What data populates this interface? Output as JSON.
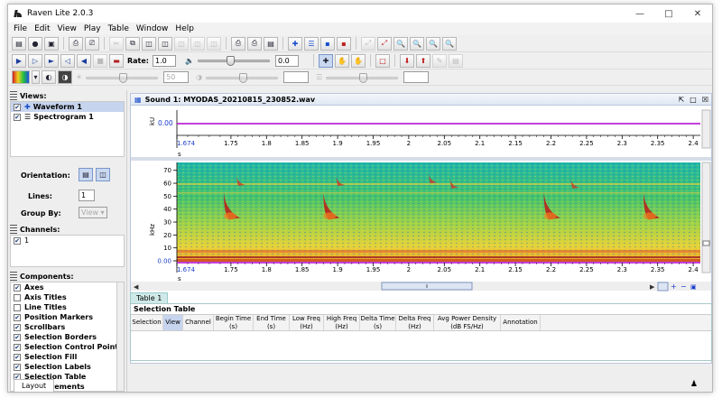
{
  "window": {
    "title": "Raven Lite 2.0.3",
    "minimize_icon": "minimize-icon",
    "maximize_icon": "maximize-icon",
    "close_icon": "close-icon"
  },
  "menu": [
    "File",
    "Edit",
    "View",
    "Play",
    "Table",
    "Window",
    "Help"
  ],
  "play_toolbar": {
    "rate_label": "Rate:",
    "rate_value": "1.0",
    "volume_value": "0.0",
    "volume_level": 0.4
  },
  "view_toolbar": {
    "brightness_value": "50"
  },
  "views_panel": {
    "title": "Views:",
    "items": [
      {
        "label": "Waveform 1",
        "checked": true,
        "selected": true
      },
      {
        "label": "Spectrogram 1",
        "checked": true,
        "selected": false
      }
    ],
    "orientation_label": "Orientation:",
    "lines_label": "Lines:",
    "lines_value": "1",
    "group_by_label": "Group By:",
    "group_by_value": "View"
  },
  "channels_panel": {
    "title": "Channels:",
    "items": [
      {
        "label": "1",
        "checked": true
      }
    ]
  },
  "components_panel": {
    "title": "Components:",
    "items": [
      {
        "label": "Axes",
        "checked": true
      },
      {
        "label": "Axis Titles",
        "checked": false
      },
      {
        "label": "Line Titles",
        "checked": false
      },
      {
        "label": "Position Markers",
        "checked": true
      },
      {
        "label": "Scrollbars",
        "checked": true
      },
      {
        "label": "Selection Borders",
        "checked": true
      },
      {
        "label": "Selection Control Points",
        "checked": true
      },
      {
        "label": "Selection Fill",
        "checked": true
      },
      {
        "label": "Selection Labels",
        "checked": true
      },
      {
        "label": "Selection Table",
        "checked": true
      },
      {
        "label": "Measurements",
        "checked": false
      }
    ]
  },
  "sound_window": {
    "title": "Sound 1: MYODAS_20210815_230852.wav",
    "waveform": {
      "ylabel": "kU",
      "ytick": "0.00",
      "xunit": "s"
    },
    "spectrogram": {
      "ylabel": "kHz",
      "yticks": [
        "70",
        "60",
        "50",
        "40",
        "30",
        "20",
        "10",
        "0.00"
      ],
      "xunit": "s"
    },
    "xticks": [
      "1.674",
      "1.75",
      "1.8",
      "1.85",
      "1.9",
      "1.95",
      "2",
      "2.05",
      "2.1",
      "2.15",
      "2.2",
      "2.25",
      "2.3",
      "2.35",
      "2.4"
    ]
  },
  "selection_table": {
    "tab_label": "Table 1",
    "title": "Selection Table",
    "columns": [
      "Selection",
      "View",
      "Channel",
      "Begin Time\n(s)",
      "End Time\n(s)",
      "Low Freq\n(Hz)",
      "High Freq\n(Hz)",
      "Delta Time\n(s)",
      "Delta Freq\n(Hz)",
      "Avg Power Density\n(dB FS/Hz)",
      "Annotation"
    ]
  },
  "status": {
    "layout_tab": "Layout"
  }
}
